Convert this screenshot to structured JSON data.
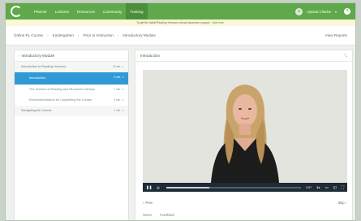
{
  "nav": {
    "items": [
      {
        "label": "Planner"
      },
      {
        "label": "Lessons"
      },
      {
        "label": "Resources"
      },
      {
        "label": "Community"
      },
      {
        "label": "Training"
      }
    ],
    "active_index": 4,
    "user_name": "Ayaana Charles",
    "help_label": "?"
  },
  "banner": {
    "text": "To get the latest Reading Horizons virtual classroom support,",
    "link": "click here."
  },
  "breadcrumbs": {
    "items": [
      "Online PL Course",
      "Kindergarten",
      "Prior to Instruction",
      "Introductory Module"
    ],
    "view_reports": "View Reports"
  },
  "sidebar": {
    "title": "Introductory Module",
    "items": [
      {
        "label": "Introduction to Reading Horizons",
        "duration": "13 min",
        "check": "✓",
        "type": "group"
      },
      {
        "label": "Introduction",
        "duration": "9 min",
        "check": "✓",
        "type": "sub-active"
      },
      {
        "label": "The Science of Reading and Structured Literacy",
        "duration": "7 min",
        "check": "✓",
        "type": "sub"
      },
      {
        "label": "Recommendations for Completing the Course",
        "duration": "3 min",
        "check": "✓",
        "type": "sub"
      },
      {
        "label": "Navigating the Course",
        "duration": "2 min",
        "check": "✓",
        "type": "group"
      }
    ]
  },
  "main": {
    "title": "Introduction",
    "video": {
      "progress": 0.32,
      "time": "3:07",
      "speed": "1x"
    },
    "prev_label": "Prev",
    "skip_label": "Skip",
    "tabs": [
      "Notes",
      "Feedback"
    ]
  },
  "colors": {
    "brand_green": "#5fa84b",
    "active_blue": "#2f9ad6"
  }
}
